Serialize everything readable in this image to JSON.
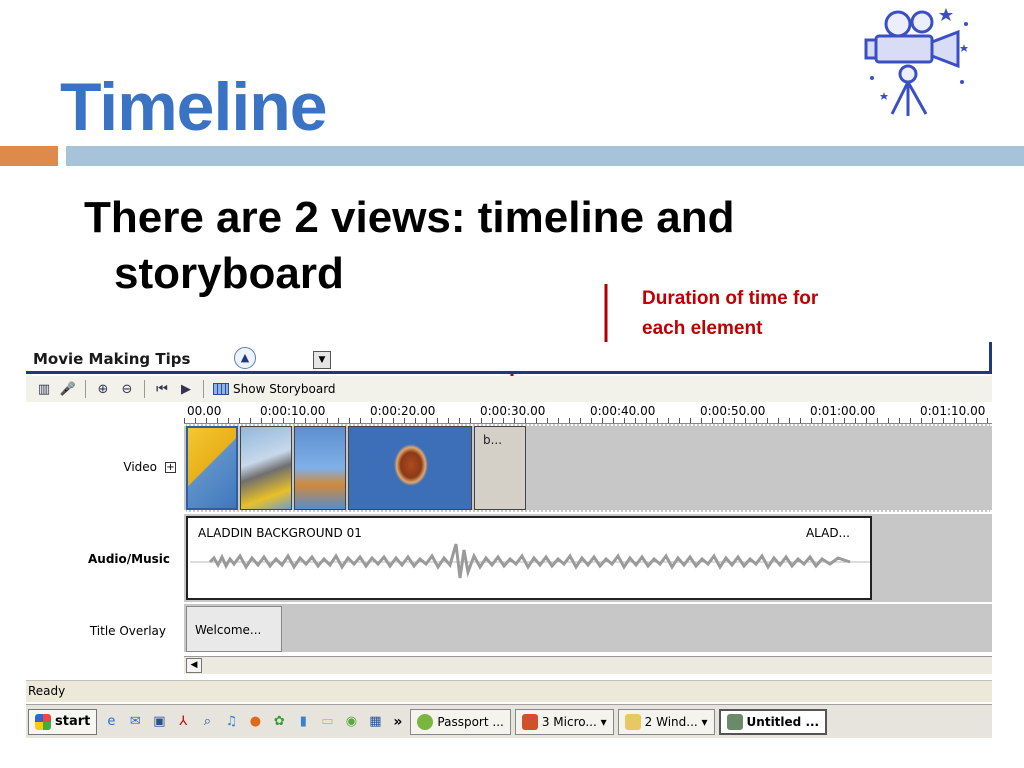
{
  "slide": {
    "title": "Timeline",
    "bullet_line1": "There are 2 views:  timeline and",
    "bullet_line2": "storyboard",
    "callout_line1": "Duration of time for",
    "callout_line2": "each element"
  },
  "app": {
    "title": "Movie Making Tips",
    "toolbar": {
      "show_storyboard": "Show Storyboard"
    },
    "ruler": [
      "00.00",
      "0:00:10.00",
      "0:00:20.00",
      "0:00:30.00",
      "0:00:40.00",
      "0:00:50.00",
      "0:01:00.00",
      "0:01:10.00"
    ],
    "tracks": {
      "video": "Video",
      "audio": "Audio/Music",
      "title": "Title Overlay"
    },
    "clips": {
      "video_last": "b...",
      "audio_name": "ALADDIN BACKGROUND 01",
      "audio_name2": "ALAD...",
      "title_clip": "Welcome..."
    },
    "status": "Ready"
  },
  "taskbar": {
    "start": "start",
    "more": "»",
    "tasks": [
      "Passport ...",
      "3 Micro... ▾",
      "2 Wind... ▾",
      "Untitled ..."
    ]
  },
  "colors": {
    "title_blue": "#3b73c4",
    "callout_red": "#c00000",
    "accent_orange": "#dd8a4c",
    "accent_bar": "#a7c3d9",
    "track_gray": "#c7c7c7",
    "app_navy": "#1f3a7a"
  },
  "icons": {
    "camera": "movie-camera-icon",
    "collapse": "chevron-up-icon",
    "dropdown": "chevron-down-icon"
  }
}
